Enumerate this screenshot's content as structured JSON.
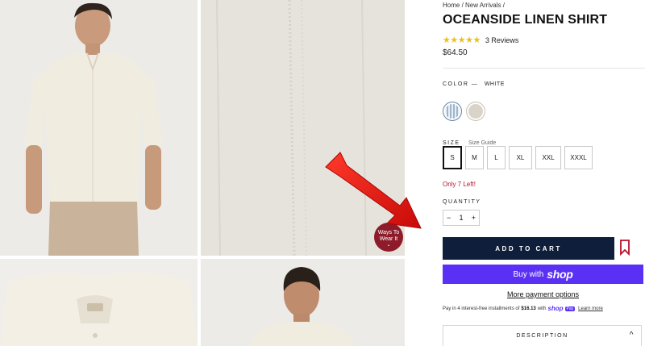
{
  "breadcrumb": [
    "Home",
    "New Arrivals"
  ],
  "product": {
    "title": "OCEANSIDE LINEN SHIRT",
    "stars": "★★★★★",
    "reviews": "3 Reviews",
    "price": "$64.50"
  },
  "color": {
    "label": "COLOR",
    "separator": "—",
    "value": "WHITE",
    "swatches": [
      "blue-stripe-swatch",
      "white-swatch"
    ]
  },
  "size": {
    "label": "SIZE",
    "guide": "Size Guide",
    "options": [
      "S",
      "M",
      "L",
      "XL",
      "XXL",
      "XXXL"
    ],
    "selected": "S"
  },
  "stock": "Only 7 Left!",
  "quantity": {
    "label": "QUANTITY",
    "minus": "−",
    "value": "1",
    "plus": "+"
  },
  "actions": {
    "add_to_cart": "ADD TO CART",
    "buy_with": "Buy with",
    "shop_logo": "shop",
    "more_payment": "More payment options"
  },
  "installments": {
    "prefix": "Pay in 4 interest-free installments of",
    "amount": "$16.13",
    "with": "with",
    "shop": "shop",
    "pay": "Pay",
    "learn_more": "Learn more"
  },
  "description": {
    "label": "DESCRIPTION",
    "chevron": "^"
  },
  "gallery": {
    "badge_line1": "Ways To",
    "badge_line2": "Wear It",
    "badge_chevron": "⌄"
  },
  "colors": {
    "navy": "#0f1e3a",
    "shop_purple": "#5a31f4",
    "stock_red": "#b5122b",
    "star_gold": "#e8c21c",
    "badge": "#8e1b2a",
    "arrow": "#e0120e"
  },
  "icons": [
    "bookmark-icon",
    "chevron-up-icon",
    "annotation-arrow"
  ]
}
